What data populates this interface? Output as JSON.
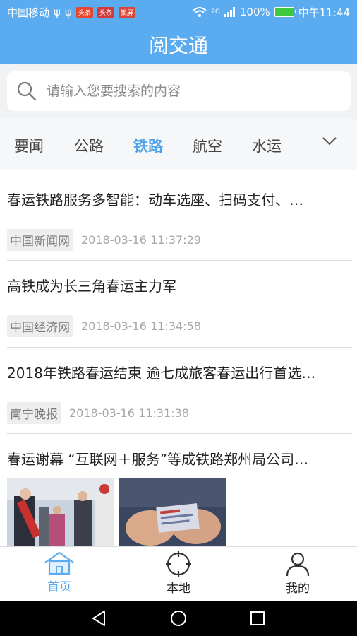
{
  "status_bar": {
    "carrier": "中国移动",
    "badges": [
      "头条",
      "头条",
      "锁屏"
    ],
    "network": "2G",
    "battery": "100%",
    "time": "中午11:44"
  },
  "app": {
    "title": "阅交通"
  },
  "search": {
    "placeholder": "请输入您要搜索的内容"
  },
  "tabs": [
    {
      "label": "要闻",
      "active": false
    },
    {
      "label": "公路",
      "active": false
    },
    {
      "label": "铁路",
      "active": true
    },
    {
      "label": "航空",
      "active": false
    },
    {
      "label": "水运",
      "active": false
    }
  ],
  "news": [
    {
      "title": "春运铁路服务多智能：动车选座、扫码支付、…",
      "source": "中国新闻网",
      "time": "2018-03-16 11:37:29"
    },
    {
      "title": "高铁成为长三角春运主力军",
      "source": "中国经济网",
      "time": "2018-03-16 11:34:58"
    },
    {
      "title": "2018年铁路春运结束 逾七成旅客春运出行首选…",
      "source": "南宁晚报",
      "time": "2018-03-16 11:31:38"
    },
    {
      "title": "春运谢幕 “互联网＋服务”等成铁路郑州局公司…"
    }
  ],
  "bottom_nav": [
    {
      "label": "首页",
      "active": true
    },
    {
      "label": "本地",
      "active": false
    },
    {
      "label": "我的",
      "active": false
    }
  ],
  "colors": {
    "primary": "#5aabef",
    "active_tab": "#4ea3ea"
  }
}
